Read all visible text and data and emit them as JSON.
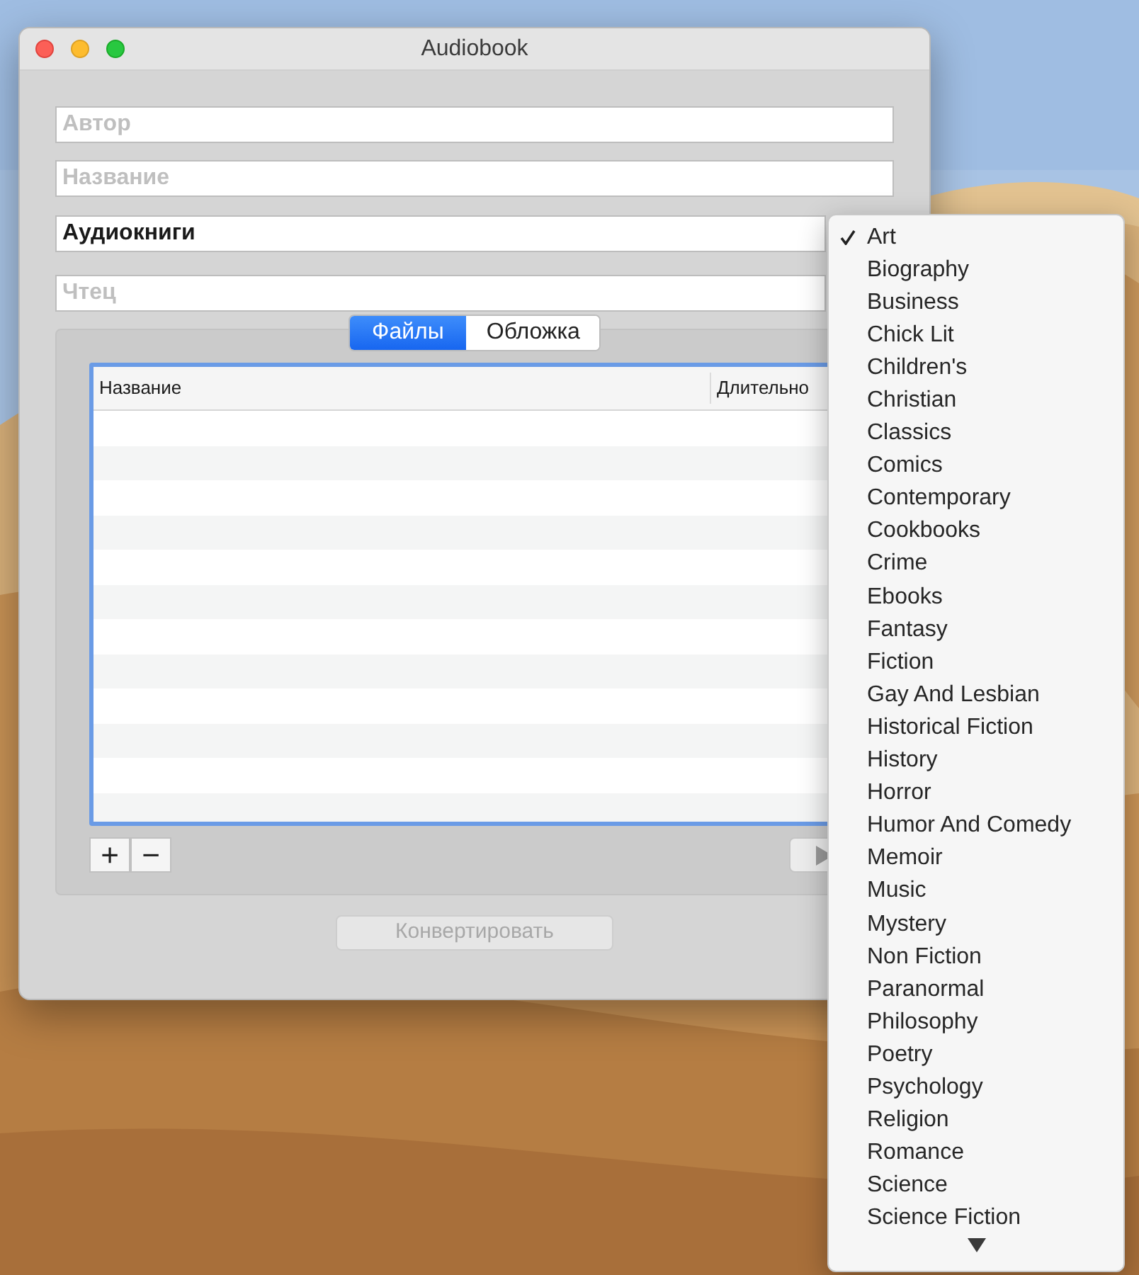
{
  "window": {
    "title": "Audiobook"
  },
  "fields": [
    {
      "placeholder": "Автор"
    },
    {
      "placeholder": "Название"
    },
    {
      "value": "Аудиокниги"
    },
    {
      "placeholder": "Чтец"
    }
  ],
  "tabs": [
    {
      "label": "Файлы",
      "selected": true
    },
    {
      "label": "Обложка",
      "selected": false
    }
  ],
  "table": {
    "columns": [
      "Название",
      "Длительно"
    ]
  },
  "list_buttons": [
    "+",
    "−"
  ],
  "convert_button": {
    "label": "Конвертировать",
    "disabled": true
  },
  "genre_menu": {
    "items": [
      {
        "label": "Art",
        "checked": true
      },
      {
        "label": "Biography",
        "checked": false
      },
      {
        "label": "Business",
        "checked": false
      },
      {
        "label": "Chick Lit",
        "checked": false
      },
      {
        "label": "Children's",
        "checked": false
      },
      {
        "label": "Christian",
        "checked": false
      },
      {
        "label": "Classics",
        "checked": false
      },
      {
        "label": "Comics",
        "checked": false
      },
      {
        "label": "Contemporary",
        "checked": false
      },
      {
        "label": "Cookbooks",
        "checked": false
      },
      {
        "label": "Crime",
        "checked": false
      },
      {
        "label": "Ebooks",
        "checked": false
      },
      {
        "label": "Fantasy",
        "checked": false
      },
      {
        "label": "Fiction",
        "checked": false
      },
      {
        "label": "Gay And Lesbian",
        "checked": false
      },
      {
        "label": "Historical Fiction",
        "checked": false
      },
      {
        "label": "History",
        "checked": false
      },
      {
        "label": "Horror",
        "checked": false
      },
      {
        "label": "Humor And Comedy",
        "checked": false
      },
      {
        "label": "Memoir",
        "checked": false
      },
      {
        "label": "Music",
        "checked": false
      },
      {
        "label": "Mystery",
        "checked": false
      },
      {
        "label": "Non Fiction",
        "checked": false
      },
      {
        "label": "Paranormal",
        "checked": false
      },
      {
        "label": "Philosophy",
        "checked": false
      },
      {
        "label": "Poetry",
        "checked": false
      },
      {
        "label": "Psychology",
        "checked": false
      },
      {
        "label": "Religion",
        "checked": false
      },
      {
        "label": "Romance",
        "checked": false
      },
      {
        "label": "Science",
        "checked": false
      },
      {
        "label": "Science Fiction",
        "checked": false
      }
    ]
  }
}
